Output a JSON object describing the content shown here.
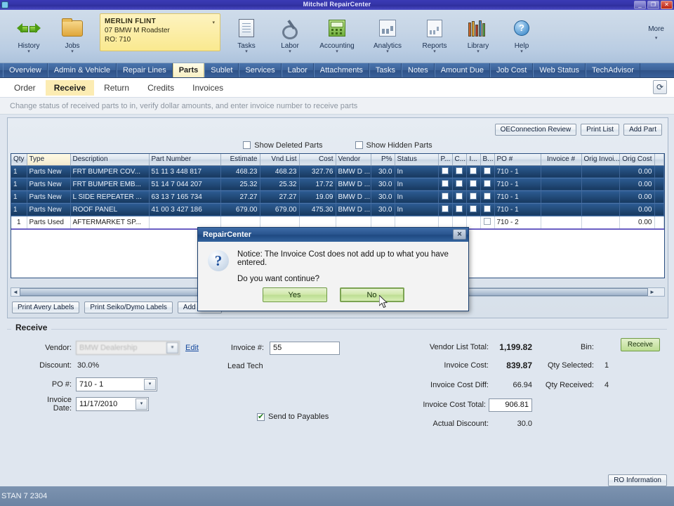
{
  "window": {
    "title": "Mitchell RepairCenter",
    "minimize": "_",
    "maximize": "❐",
    "close": "✕"
  },
  "ribbon": {
    "items": [
      {
        "label": "History",
        "icon": "back-forward-arrows-icon"
      },
      {
        "label": "Jobs",
        "icon": "folder-icon"
      },
      {
        "label": "Tasks",
        "icon": "clipboard-icon"
      },
      {
        "label": "Labor",
        "icon": "wrench-icon"
      },
      {
        "label": "Accounting",
        "icon": "calculator-icon"
      },
      {
        "label": "Analytics",
        "icon": "chart-icon"
      },
      {
        "label": "Reports",
        "icon": "report-icon"
      },
      {
        "label": "Library",
        "icon": "books-icon"
      },
      {
        "label": "Help",
        "icon": "question-circle-icon"
      }
    ],
    "more_label": "More",
    "vehicle_card": {
      "customer": "MERLIN FLINT",
      "vehicle": "07 BMW M Roadster",
      "ro": "RO: 710"
    }
  },
  "main_tabs": [
    {
      "label": "Overview",
      "active": false
    },
    {
      "label": "Admin & Vehicle",
      "active": false
    },
    {
      "label": "Repair Lines",
      "active": false
    },
    {
      "label": "Parts",
      "active": true
    },
    {
      "label": "Sublet",
      "active": false
    },
    {
      "label": "Services",
      "active": false
    },
    {
      "label": "Labor",
      "active": false
    },
    {
      "label": "Attachments",
      "active": false
    },
    {
      "label": "Tasks",
      "active": false
    },
    {
      "label": "Notes",
      "active": false
    },
    {
      "label": "Amount Due",
      "active": false
    },
    {
      "label": "Job Cost",
      "active": false
    },
    {
      "label": "Web Status",
      "active": false
    },
    {
      "label": "TechAdvisor",
      "active": false
    }
  ],
  "sub_tabs": [
    {
      "label": "Order",
      "active": false
    },
    {
      "label": "Receive",
      "active": true
    },
    {
      "label": "Return",
      "active": false
    },
    {
      "label": "Credits",
      "active": false
    },
    {
      "label": "Invoices",
      "active": false
    }
  ],
  "refresh_icon": "refresh-icon",
  "instruction": "Change status of received parts to in, verify dollar amounts, and enter invoice number to receive parts",
  "panel_toolbar": {
    "oe_connection_review": "OEConnection Review",
    "print_list": "Print List",
    "add_part": "Add Part"
  },
  "filters": {
    "show_deleted_parts": {
      "label": "Show Deleted Parts",
      "checked": false
    },
    "show_hidden_parts": {
      "label": "Show Hidden Parts",
      "checked": false
    }
  },
  "grid": {
    "columns": [
      "Qty",
      "Type",
      "Description",
      "Part Number",
      "Estimate",
      "Vnd List",
      "Cost",
      "Vendor",
      "P%",
      "Status",
      "P...",
      "C...",
      "I...",
      "B...",
      "PO #",
      "Invoice #",
      "Orig Invoi...",
      "Orig Cost"
    ],
    "rows": [
      {
        "qty": "1",
        "type": "Parts New",
        "description": "FRT BUMPER COV...",
        "part_number": "51 11 3 448 817",
        "estimate": "468.23",
        "vnd_list": "468.23",
        "cost": "327.76",
        "vendor": "BMW D ...",
        "pct": "30.0",
        "status": "In",
        "po": "710 - 1",
        "invoice": "",
        "orig_invoice": "",
        "orig_cost": "0.00",
        "selected": true
      },
      {
        "qty": "1",
        "type": "Parts New",
        "description": "FRT BUMPER EMB...",
        "part_number": "51 14 7 044 207",
        "estimate": "25.32",
        "vnd_list": "25.32",
        "cost": "17.72",
        "vendor": "BMW D ...",
        "pct": "30.0",
        "status": "In",
        "po": "710 - 1",
        "invoice": "",
        "orig_invoice": "",
        "orig_cost": "0.00",
        "selected": true
      },
      {
        "qty": "1",
        "type": "Parts New",
        "description": "L SIDE REPEATER ...",
        "part_number": "63 13 7 165 734",
        "estimate": "27.27",
        "vnd_list": "27.27",
        "cost": "19.09",
        "vendor": "BMW D ...",
        "pct": "30.0",
        "status": "In",
        "po": "710 - 1",
        "invoice": "",
        "orig_invoice": "",
        "orig_cost": "0.00",
        "selected": true
      },
      {
        "qty": "1",
        "type": "Parts New",
        "description": "ROOF PANEL",
        "part_number": "41 00 3 427 186",
        "estimate": "679.00",
        "vnd_list": "679.00",
        "cost": "475.30",
        "vendor": "BMW D ...",
        "pct": "30.0",
        "status": "In",
        "po": "710 - 1",
        "invoice": "",
        "orig_invoice": "",
        "orig_cost": "0.00",
        "selected": true
      },
      {
        "qty": "1",
        "type": "Parts Used",
        "description": "AFTERMARKET SP...",
        "part_number": "",
        "estimate": "",
        "vnd_list": "",
        "cost": "",
        "vendor": "",
        "pct": "",
        "status": "",
        "po": "710 - 2",
        "invoice": "",
        "orig_invoice": "",
        "orig_cost": "0.00",
        "selected": false
      }
    ]
  },
  "label_buttons": {
    "print_avery": "Print Avery Labels",
    "print_seiko": "Print Seiko/Dymo Labels",
    "add_to_stock": "Add to S..."
  },
  "receive_form": {
    "group_title": "Receive",
    "vendor_label": "Vendor:",
    "vendor_value": "BMW Dealership",
    "edit_link": "Edit",
    "discount_label": "Discount:",
    "discount_value": "30.0%",
    "po_label": "PO #:",
    "po_value": "710 - 1",
    "invoice_date_label": "Invoice Date:",
    "invoice_date_value": "11/17/2010",
    "invoice_num_label": "Invoice #:",
    "invoice_num_value": "55",
    "lead_tech_label": "Lead Tech",
    "send_to_payables_label": "Send to Payables",
    "send_to_payables_checked": true,
    "vendor_list_total_label": "Vendor List Total:",
    "vendor_list_total_value": "1,199.82",
    "invoice_cost_label": "Invoice Cost:",
    "invoice_cost_value": "839.87",
    "invoice_cost_diff_label": "Invoice Cost Diff:",
    "invoice_cost_diff_value": "66.94",
    "invoice_cost_total_label": "Invoice Cost Total:",
    "invoice_cost_total_value": "906.81",
    "actual_discount_label": "Actual Discount:",
    "actual_discount_value": "30.0",
    "bin_label": "Bin:",
    "bin_value": "",
    "qty_selected_label": "Qty Selected:",
    "qty_selected_value": "1",
    "qty_received_label": "Qty Received:",
    "qty_received_value": "4",
    "receive_button": "Receive",
    "ro_information_button": "RO Information"
  },
  "dialog": {
    "title": "RepairCenter",
    "close_icon": "close-icon",
    "icon": "question-mark-icon",
    "message_line1": "Notice: The Invoice Cost does not add up to what you have entered.",
    "message_line2": "Do you want continue?",
    "yes_button": "Yes",
    "no_button": "No"
  },
  "statusbar": {
    "text": "STAN 7 2304"
  },
  "colors": {
    "accent_blue": "#2f5288",
    "active_tab_yellow": "#fcecb3",
    "grid_selection": "#2d5c94",
    "green_button": "#bcdd92"
  }
}
